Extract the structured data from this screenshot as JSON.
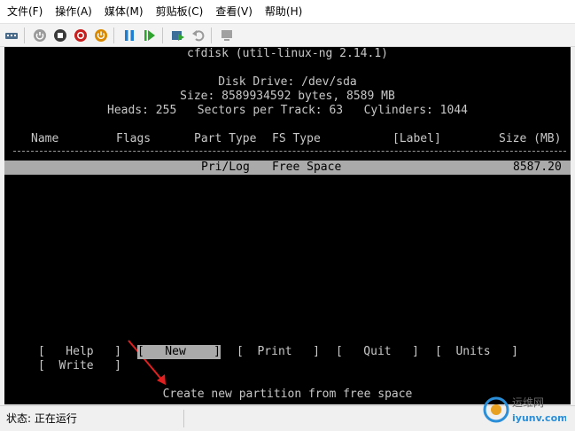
{
  "menu": [
    "文件(F)",
    "操作(A)",
    "媒体(M)",
    "剪贴板(C)",
    "查看(V)",
    "帮助(H)"
  ],
  "toolbar_icons": [
    "ctrl-alt-del-icon",
    "start-icon",
    "turn-off-icon",
    "shut-down-icon",
    "power-icon",
    "pause-icon",
    "resume-icon",
    "checkpoint-icon",
    "revert-icon",
    "enhanced-session-icon"
  ],
  "console": {
    "title": "cfdisk (util-linux-ng 2.14.1)",
    "disk_drive": "Disk Drive: /dev/sda",
    "size_line": "Size: 8589934592 bytes, 8589 MB",
    "geometry_line": "Heads: 255   Sectors per Track: 63   Cylinders: 1044",
    "headers": {
      "name": "Name",
      "flags": "Flags",
      "part_type": "Part Type",
      "fs_type": "FS Type",
      "label": "[Label]",
      "size": "Size (MB)"
    },
    "rows": [
      {
        "part_type": "Pri/Log",
        "fs_type": "Free Space",
        "size": "8587.20"
      }
    ],
    "commands": {
      "help": "[   Help   ]",
      "new": "[   New    ]",
      "print": "[  Print   ]",
      "quit": "[   Quit   ]",
      "units": "[  Units   ]",
      "write": "[  Write   ]"
    },
    "hint": "Create new partition from free space"
  },
  "status": "状态: 正在运行",
  "watermark": {
    "text": "运维网",
    "sub": "iyunv.com"
  },
  "colors": {
    "console_bg": "#000000",
    "console_fg": "#c8c8c8",
    "highlight": "#aaaaaa",
    "arrow": "#e02020"
  }
}
